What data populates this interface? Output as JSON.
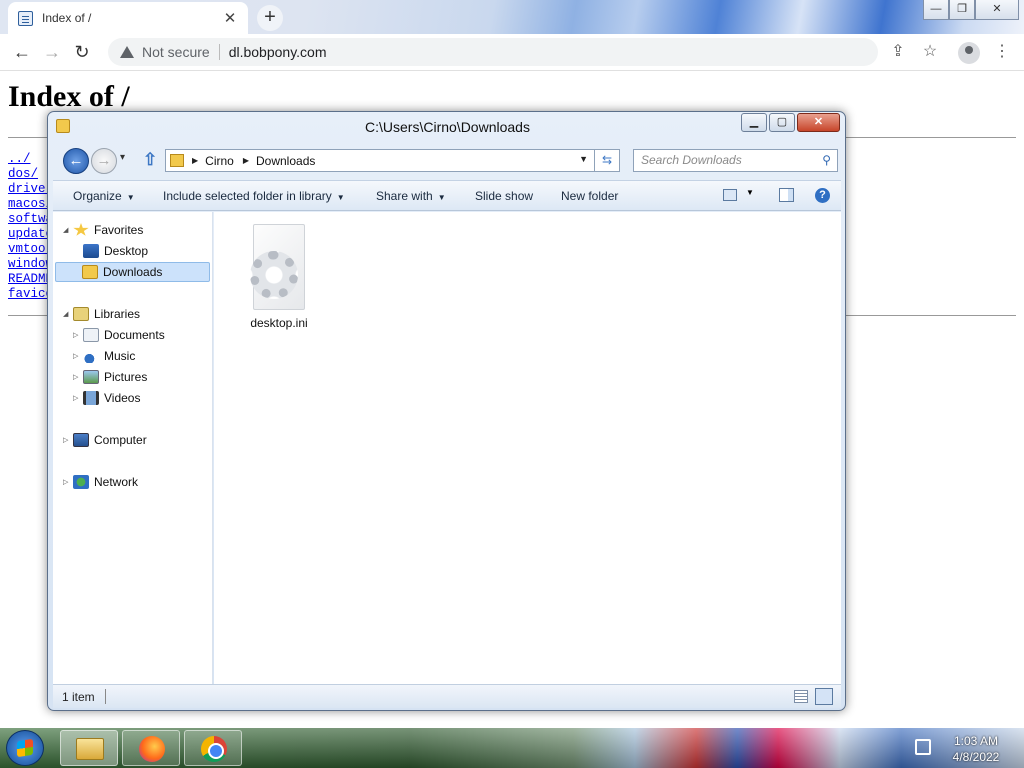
{
  "browser": {
    "tab_title": "Index of /",
    "tab_close": "✕",
    "new_tab": "+",
    "window_min": "—",
    "window_restore": "❐",
    "window_close": "✕",
    "back": "←",
    "forward": "→",
    "reload": "↻",
    "not_secure": "Not secure",
    "url": "dl.bobpony.com",
    "share": "⇪",
    "bookmark": "☆",
    "menu": "⋮"
  },
  "page": {
    "heading": "Index of /",
    "links": [
      "../",
      "dos/",
      "drivers/",
      "macos/",
      "software/",
      "updates/",
      "vmtools/",
      "windows/",
      "README",
      "favicon.ico"
    ]
  },
  "explorer": {
    "title": "C:\\Users\\Cirno\\Downloads",
    "minimize": "▁",
    "maximize": "▢",
    "close": "✕",
    "back": "←",
    "forward": "→",
    "nav_dropdown": "▾",
    "up": "⇧",
    "breadcrumb": [
      "Cirno",
      "Downloads"
    ],
    "breadcrumb_sep": "▶",
    "address_dropdown": "▼",
    "refresh": "⇆",
    "search_placeholder": "Search Downloads",
    "search_icon": "⚲",
    "commands": {
      "organize": "Organize",
      "include": "Include selected folder in library",
      "share": "Share with",
      "slideshow": "Slide show",
      "newfolder": "New folder",
      "arrow": "▼"
    },
    "help": "?",
    "nav": {
      "favorites": "Favorites",
      "desktop": "Desktop",
      "downloads": "Downloads",
      "libraries": "Libraries",
      "documents": "Documents",
      "music": "Music",
      "pictures": "Pictures",
      "videos": "Videos",
      "computer": "Computer",
      "network": "Network",
      "expanded": "◢",
      "collapsed": "▷"
    },
    "files": [
      {
        "name": "desktop.ini"
      }
    ],
    "status": "1 item"
  },
  "taskbar": {
    "time": "1:03 AM",
    "date": "4/8/2022"
  },
  "colors": {
    "link": "#0000ee",
    "selection": "#cce2fb"
  }
}
